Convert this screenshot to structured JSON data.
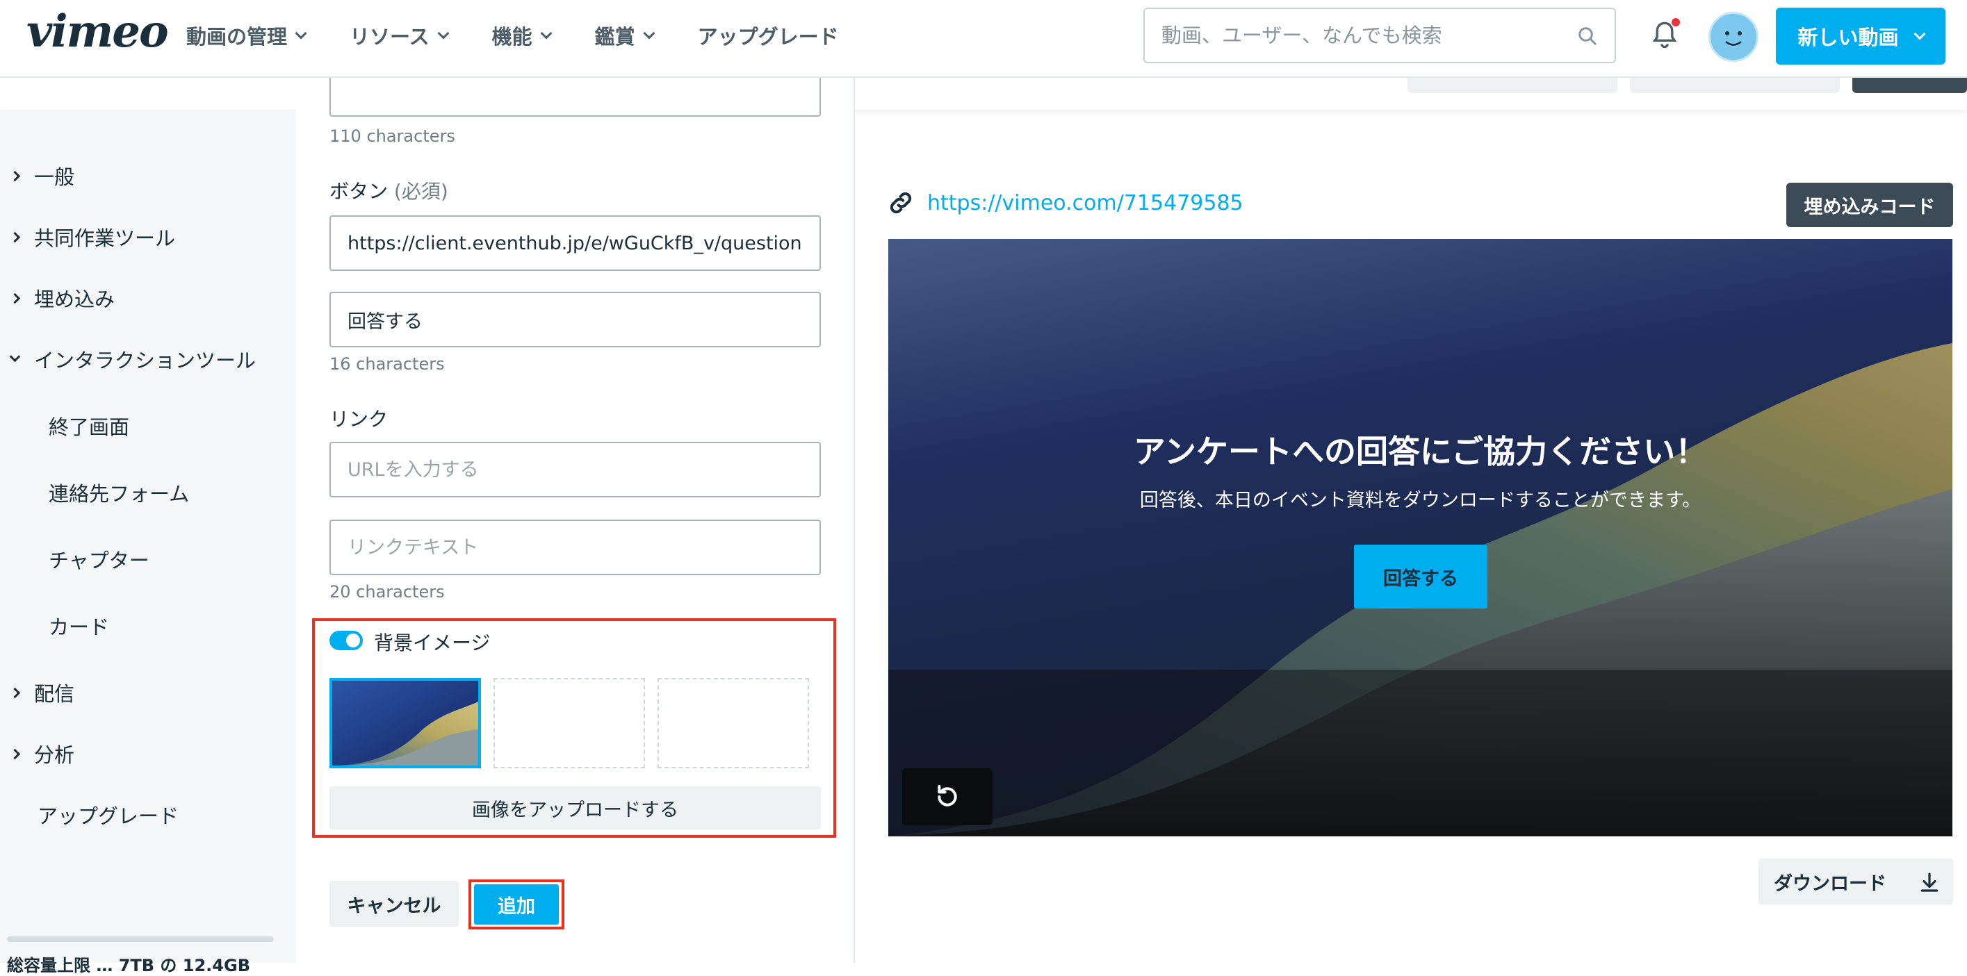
{
  "header": {
    "logo": "vimeo",
    "nav": [
      {
        "label": "動画の管理"
      },
      {
        "label": "リソース"
      },
      {
        "label": "機能"
      },
      {
        "label": "鑑賞"
      },
      {
        "label": "アップグレード"
      }
    ],
    "search_placeholder": "動画、ユーザー、なんでも検索",
    "new_video_label": "新しい動画",
    "notification_dot_color": "#f5323c",
    "accent_color": "#00adef"
  },
  "sidebar": {
    "items": [
      {
        "label": "一般"
      },
      {
        "label": "共同作業ツール"
      },
      {
        "label": "埋め込み"
      },
      {
        "label": "インタラクションツール"
      },
      {
        "label": "終了画面"
      },
      {
        "label": "連絡先フォーム"
      },
      {
        "label": "チャプター"
      },
      {
        "label": "カード"
      },
      {
        "label": "配信"
      },
      {
        "label": "分析"
      },
      {
        "label": "アップグレード"
      }
    ],
    "storage_text": "総容量上限 … 7TB の 12.4GB"
  },
  "form": {
    "top_char_count": "110 characters",
    "button_label": "ボタン",
    "button_required": "(必須)",
    "button_url_value": "https://client.eventhub.jp/e/wGuCkfB_v/questionnaire",
    "button_text_value": "回答する",
    "button_text_count": "16 characters",
    "link_label": "リンク",
    "link_url_placeholder": "URLを入力する",
    "link_text_placeholder": "リンクテキスト",
    "link_text_count": "20 characters",
    "background_image_label": "背景イメージ",
    "background_image_enabled": true,
    "upload_label": "画像をアップロードする",
    "cancel_label": "キャンセル",
    "add_label": "追加"
  },
  "preview": {
    "url": "https://vimeo.com/715479585",
    "embed_label": "埋め込みコード",
    "overlay_title": "アンケートへの回答にご協力ください！",
    "overlay_subtitle": "回答後、本日のイベント資料をダウンロードすることができます。",
    "overlay_button": "回答する",
    "download_label": "ダウンロード"
  }
}
